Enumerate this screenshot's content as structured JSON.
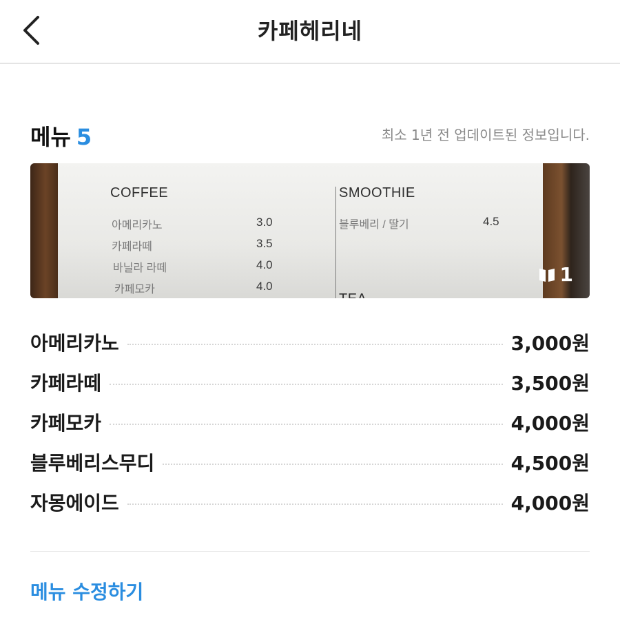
{
  "header": {
    "title": "카페헤리네",
    "back_icon": "chevron-left-icon"
  },
  "menu_section": {
    "title": "메뉴",
    "count": "5",
    "update_note": "최소 1년 전 업데이트된 정보입니다."
  },
  "photo": {
    "badge_icon": "book-icon",
    "badge_count": "1",
    "coffee_heading": "COFFEE",
    "coffee_items": [
      {
        "name": "아메리카노",
        "price": "3.0"
      },
      {
        "name": "카페라떼",
        "price": "3.5"
      },
      {
        "name": "바닐라 라떼",
        "price": "4.0"
      },
      {
        "name": "카페모카",
        "price": "4.0"
      }
    ],
    "smoothie_heading": "SMOOTHIE",
    "smoothie_items": [
      {
        "name": "블루베리 / 딸기",
        "price": "4.5"
      }
    ],
    "tea_heading": "TEA"
  },
  "menu_items": [
    {
      "name": "아메리카노",
      "price": "3,000원"
    },
    {
      "name": "카페라떼",
      "price": "3,500원"
    },
    {
      "name": "카페모카",
      "price": "4,000원"
    },
    {
      "name": "블루베리스무디",
      "price": "4,500원"
    },
    {
      "name": "자몽에이드",
      "price": "4,000원"
    }
  ],
  "edit_label": "메뉴 수정하기",
  "colors": {
    "accent": "#2a8de0",
    "divider": "#e4e4e4",
    "muted_text": "#8a8a8a"
  }
}
